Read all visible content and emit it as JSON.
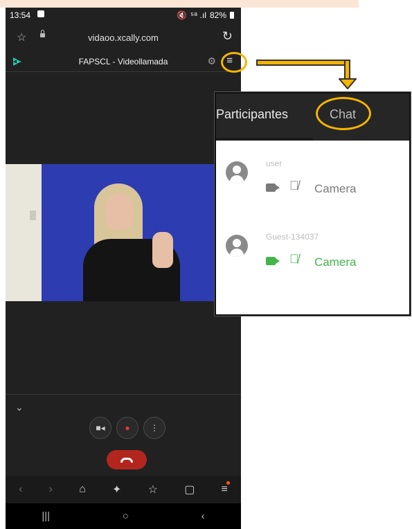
{
  "status_bar": {
    "time": "13:54",
    "signal_text": "⁵⁸ .ıl",
    "battery": "82%"
  },
  "browser": {
    "url": "vidaoo.xcally.com"
  },
  "app": {
    "title": "FAPSCL - Videollamada"
  },
  "zoom_panel": {
    "tabs": [
      {
        "label": "Participantes"
      },
      {
        "label": "Chat"
      }
    ],
    "participants": [
      {
        "name": "user",
        "source_label": "Camera",
        "active": false
      },
      {
        "name": "Guest-134037",
        "source_label": "Camera",
        "active": true
      }
    ]
  },
  "colors": {
    "accent_highlight": "#f4b400",
    "active_green": "#43b649",
    "hangup_red": "#b3261e",
    "dark_bg": "#212121"
  },
  "icons": {
    "menu": "hamburger-menu-icon",
    "settings": "gear-icon",
    "camera": "video-camera-icon",
    "mic": "microphone-icon",
    "mic_muted": "microphone-muted-icon",
    "hangup": "phone-hangup-icon"
  }
}
